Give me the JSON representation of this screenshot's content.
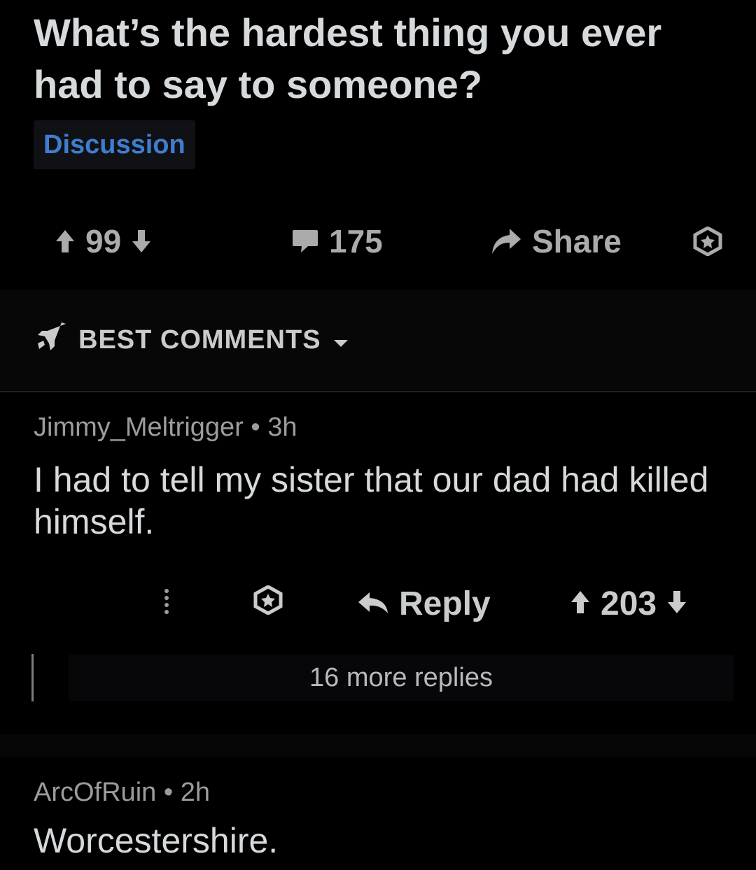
{
  "post": {
    "title": "What’s the hardest thing you ever had to say to someone?",
    "flair": "Discussion",
    "votes": "99",
    "comments": "175",
    "share_label": "Share"
  },
  "sort": {
    "label": "BEST COMMENTS"
  },
  "comments": [
    {
      "author": "Jimmy_Meltrigger",
      "time": "3h",
      "text": "I had to tell my sister that our dad had killed himself.",
      "reply_label": "Reply",
      "votes": "203",
      "more_replies": "16 more replies"
    },
    {
      "author": "ArcOfRuin",
      "time": "2h",
      "text": "Worcestershire."
    }
  ],
  "icons": {
    "upvote": "arrow-up-icon",
    "downvote": "arrow-down-icon",
    "comment": "speech-bubble-icon",
    "share": "share-arrow-icon",
    "award": "award-badge-icon",
    "sort": "rocket-icon",
    "more": "vertical-dots-icon",
    "reply": "reply-arrow-icon"
  },
  "colors": {
    "background": "#000000",
    "text": "#d7dadc",
    "flair_text": "#3f7dd0",
    "muted": "#9a9c9e"
  }
}
